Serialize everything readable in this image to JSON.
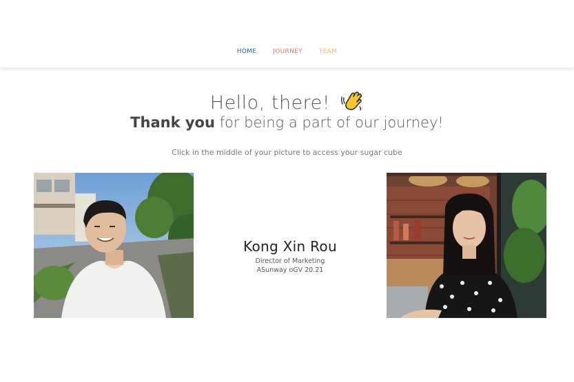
{
  "nav": {
    "items": [
      {
        "label": "HOME",
        "color": "#1565c0"
      },
      {
        "label": "JOURNEY",
        "color": "#e57368"
      },
      {
        "label": "TEAM",
        "color": "#f5b86b"
      }
    ]
  },
  "hero": {
    "greeting": "Hello, there!",
    "greeting_icon": "waving-hand-icon",
    "thanks_bold": "Thank you",
    "thanks_rest": " for being a part of our journey!",
    "instruction": "Click in the middle of your picture to access your sugar cube"
  },
  "profile": {
    "name": "Kong Xin Rou",
    "role": "Director of Marketing",
    "org": "ASunway oGV 20.21"
  },
  "photos": {
    "left_icon": "portrait-photo-man",
    "right_icon": "portrait-photo-woman"
  }
}
